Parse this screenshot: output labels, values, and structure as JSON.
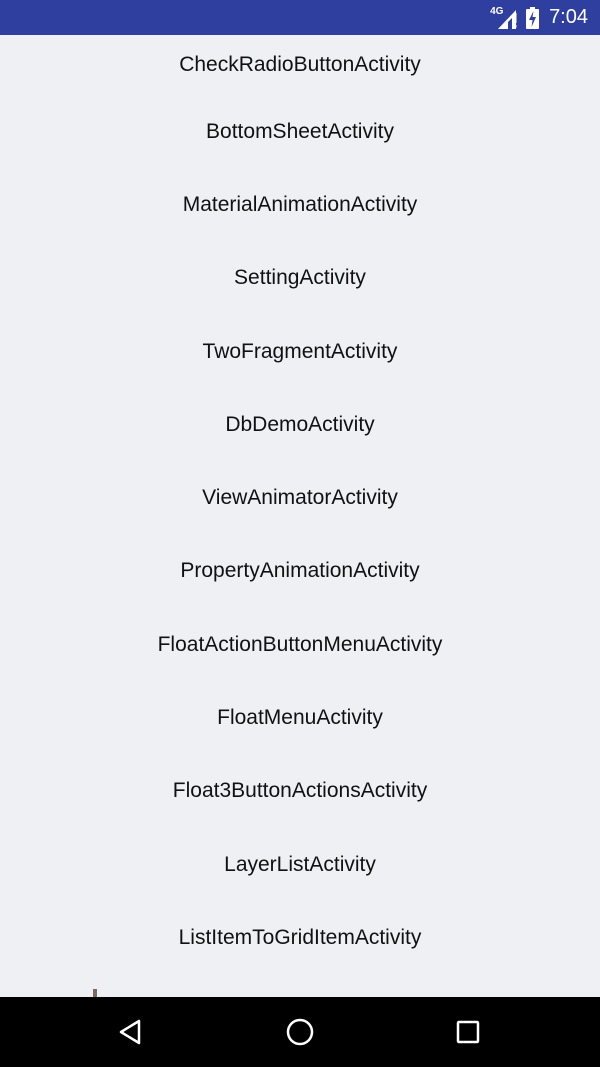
{
  "status_bar": {
    "network_type": "4G",
    "time": "7:04",
    "icons": [
      "signal-icon",
      "battery-charging-icon"
    ],
    "background_color": "#2f3fa0"
  },
  "list": {
    "items": [
      "CheckRadioButtonActivity",
      "BottomSheetActivity",
      "MaterialAnimationActivity",
      "SettingActivity",
      "TwoFragmentActivity",
      "DbDemoActivity",
      "ViewAnimatorActivity",
      "PropertyAnimationActivity",
      "FloatActionButtonMenuActivity",
      "FloatMenuActivity",
      "Float3ButtonActionsActivity",
      "LayerListActivity",
      "ListItemToGridItemActivity"
    ]
  },
  "nav_bar": {
    "icons": [
      "back-icon",
      "home-icon",
      "recents-icon"
    ]
  }
}
